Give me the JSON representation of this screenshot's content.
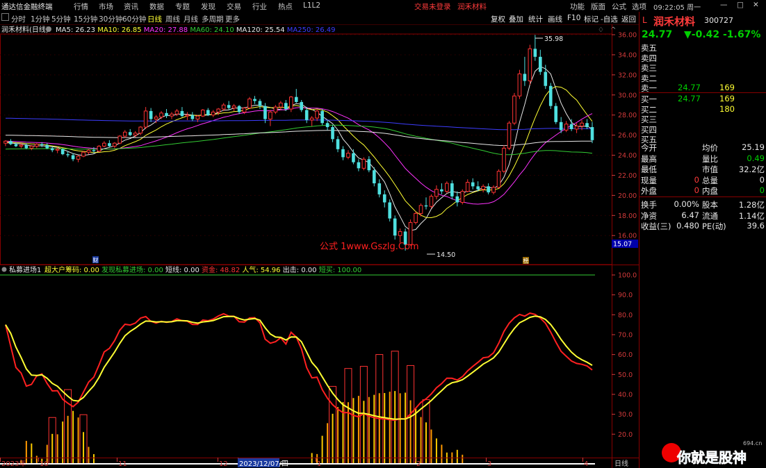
{
  "menu": {
    "app": "通达信金融终端",
    "items": [
      "行情",
      "市场",
      "资讯",
      "数据",
      "专题",
      "发现",
      "交易",
      "行业",
      "热点",
      "L1L2"
    ],
    "alerts": [
      "交易未登录",
      "润禾材料"
    ],
    "right": [
      "功能",
      "版面",
      "公式",
      "选项"
    ],
    "clock": "09:22:05 周一"
  },
  "periods": [
    "分时",
    "1分钟",
    "5分钟",
    "15分钟",
    "30分钟",
    "60分钟",
    "日线",
    "周线",
    "月线",
    "多周期",
    "更多"
  ],
  "active_period": "日线",
  "toolbar": [
    "复权",
    "叠加",
    "统计",
    "画线",
    "F10",
    "标记",
    "-自选",
    "返回"
  ],
  "ma_legend": {
    "name": "润禾材料(日线)",
    "items": [
      {
        "label": "MA5: 26.23",
        "color": "#e8e8e8"
      },
      {
        "label": "MA10: 26.85",
        "color": "#ffff33"
      },
      {
        "label": "MA20: 27.88",
        "color": "#ff33ff"
      },
      {
        "label": "MA60: 24.10",
        "color": "#33cc33"
      },
      {
        "label": "MA120: 25.54",
        "color": "#e8e8e8"
      },
      {
        "label": "MA250: 26.49",
        "color": "#3d3dff"
      }
    ]
  },
  "price_axis": [
    "36.00",
    "34.00",
    "32.00",
    "30.00",
    "28.00",
    "26.00",
    "24.00",
    "22.00",
    "20.00",
    "18.00",
    "16.00"
  ],
  "last_price_tag": "15.07",
  "annotations": {
    "high": "35.98",
    "low": "14.50",
    "watermark": "公式 1www.Gszlg.Com",
    "marker1": "财",
    "marker2": "榜"
  },
  "indicator": {
    "name": "私募进场1",
    "items": [
      {
        "label": "超大户筹码: 0.00",
        "color": "#ffff33"
      },
      {
        "label": "发现私募进场: 0.00",
        "color": "#33cc33"
      },
      {
        "label": "短线: 0.00",
        "color": "#e8e8e8"
      },
      {
        "label": "资金: 48.82",
        "color": "#ff3333"
      },
      {
        "label": "人气: 54.96",
        "color": "#ffff33"
      },
      {
        "label": "出击: 0.00",
        "color": "#e8e8e8"
      },
      {
        "label": "短买: 100.00",
        "color": "#33cc33"
      }
    ],
    "axis": [
      "100.0",
      "90.0",
      "80.0",
      "70.0",
      "60.0",
      "50.0",
      "40.0",
      "30.0",
      "20.0"
    ]
  },
  "date_axis": {
    "labels": [
      "2023年",
      "10",
      "11",
      "12",
      "2023/12/07/四",
      "1",
      "2",
      "3",
      "4"
    ],
    "period": "日线"
  },
  "quote": {
    "code_prefix": "L",
    "name": "润禾材料",
    "code": "300727",
    "price": "24.77",
    "change": "▼-0.42",
    "pct": "-1.67%",
    "sells": [
      {
        "label": "卖五",
        "price": "",
        "vol": ""
      },
      {
        "label": "卖四",
        "price": "",
        "vol": ""
      },
      {
        "label": "卖三",
        "price": "",
        "vol": ""
      },
      {
        "label": "卖二",
        "price": "",
        "vol": ""
      },
      {
        "label": "卖一",
        "price": "24.77",
        "vol": "169"
      }
    ],
    "buys": [
      {
        "label": "买一",
        "price": "24.77",
        "vol": "169"
      },
      {
        "label": "买二",
        "price": "",
        "vol": "180"
      },
      {
        "label": "买三",
        "price": "",
        "vol": ""
      },
      {
        "label": "买四",
        "price": "",
        "vol": ""
      },
      {
        "label": "买五",
        "price": "",
        "vol": ""
      }
    ],
    "stats": [
      {
        "l": "今开",
        "lv": "",
        "r": "均价",
        "rv": "25.19",
        "lc": "white",
        "rc": "white"
      },
      {
        "l": "最高",
        "lv": "",
        "r": "量比",
        "rv": "0.49",
        "lc": "white",
        "rc": "green"
      },
      {
        "l": "最低",
        "lv": "",
        "r": "市值",
        "rv": "32.2亿",
        "lc": "white",
        "rc": "white"
      },
      {
        "l": "现量",
        "lv": "0",
        "r": "总量",
        "rv": "0",
        "lc": "red",
        "rc": "white"
      },
      {
        "l": "外盘",
        "lv": "0",
        "r": "内盘",
        "rv": "0",
        "lc": "red",
        "rc": "green"
      }
    ],
    "stats2": [
      {
        "l": "换手",
        "lv": "0.00%",
        "r": "股本",
        "rv": "1.28亿"
      },
      {
        "l": "净资",
        "lv": "6.47",
        "r": "流通",
        "rv": "1.14亿"
      },
      {
        "l": "收益(三)",
        "lv": "0.480",
        "r": "PE(动)",
        "rv": "39.6"
      }
    ]
  },
  "logo": {
    "text": "你就是股神",
    "site": "694.cn"
  },
  "colors": {
    "up": "#ff3333",
    "down": "#4fe0e0",
    "bg": "#000000",
    "grid": "#800000"
  },
  "chart_data": {
    "type": "candlestick",
    "ohlc": [
      [
        25.2,
        25.5,
        24.9,
        25.4
      ],
      [
        25.4,
        25.6,
        25.0,
        25.1
      ],
      [
        25.1,
        25.3,
        24.8,
        24.9
      ],
      [
        24.9,
        25.2,
        24.7,
        25.0
      ],
      [
        25.0,
        25.2,
        24.6,
        24.7
      ],
      [
        24.7,
        25.0,
        24.5,
        24.9
      ],
      [
        24.9,
        25.2,
        24.7,
        25.1
      ],
      [
        25.1,
        25.3,
        24.8,
        25.0
      ],
      [
        25.0,
        25.2,
        24.6,
        24.7
      ],
      [
        24.7,
        24.9,
        24.3,
        24.5
      ],
      [
        24.5,
        24.8,
        24.2,
        24.6
      ],
      [
        24.6,
        24.7,
        24.0,
        24.1
      ],
      [
        24.1,
        24.4,
        23.8,
        24.0
      ],
      [
        24.0,
        24.2,
        23.4,
        23.6
      ],
      [
        23.6,
        24.0,
        23.3,
        23.9
      ],
      [
        23.9,
        24.4,
        23.8,
        24.3
      ],
      [
        24.3,
        24.6,
        24.1,
        24.5
      ],
      [
        24.5,
        24.8,
        24.2,
        24.4
      ],
      [
        24.4,
        25.0,
        24.3,
        24.9
      ],
      [
        24.9,
        25.4,
        24.8,
        25.2
      ],
      [
        25.2,
        25.5,
        24.8,
        24.9
      ],
      [
        24.9,
        25.3,
        24.7,
        25.2
      ],
      [
        25.2,
        26.0,
        25.1,
        25.9
      ],
      [
        25.9,
        26.5,
        25.7,
        26.3
      ],
      [
        26.3,
        26.6,
        25.9,
        26.0
      ],
      [
        26.0,
        26.4,
        25.8,
        26.2
      ],
      [
        26.2,
        26.9,
        26.0,
        26.8
      ],
      [
        26.8,
        28.8,
        26.6,
        28.4
      ],
      [
        28.4,
        28.7,
        27.3,
        27.6
      ],
      [
        27.6,
        28.0,
        27.2,
        27.8
      ],
      [
        27.8,
        28.4,
        27.6,
        28.2
      ],
      [
        28.2,
        28.6,
        27.7,
        27.9
      ],
      [
        27.9,
        28.3,
        27.6,
        28.1
      ],
      [
        28.1,
        28.6,
        27.9,
        28.4
      ],
      [
        28.4,
        28.8,
        27.8,
        27.9
      ],
      [
        27.9,
        28.3,
        27.5,
        28.0
      ],
      [
        28.0,
        28.3,
        27.4,
        27.6
      ],
      [
        27.6,
        28.0,
        27.3,
        27.9
      ],
      [
        27.9,
        28.6,
        27.8,
        28.5
      ],
      [
        28.5,
        28.7,
        27.9,
        28.0
      ],
      [
        28.0,
        28.5,
        27.8,
        28.3
      ],
      [
        28.3,
        28.7,
        28.0,
        28.6
      ],
      [
        28.6,
        29.2,
        28.4,
        29.0
      ],
      [
        29.0,
        29.4,
        28.5,
        28.7
      ],
      [
        28.7,
        29.1,
        28.4,
        28.9
      ],
      [
        28.9,
        29.0,
        28.1,
        28.3
      ],
      [
        28.3,
        28.8,
        28.1,
        28.7
      ],
      [
        28.7,
        29.8,
        28.6,
        29.6
      ],
      [
        29.6,
        29.9,
        29.1,
        29.4
      ],
      [
        29.4,
        29.6,
        28.6,
        28.9
      ],
      [
        28.9,
        29.2,
        27.2,
        27.6
      ],
      [
        27.6,
        28.5,
        26.9,
        28.3
      ],
      [
        28.3,
        29.0,
        28.1,
        28.8
      ],
      [
        28.8,
        29.4,
        28.5,
        29.2
      ],
      [
        29.2,
        29.5,
        28.4,
        28.6
      ],
      [
        28.6,
        29.9,
        28.3,
        29.8
      ],
      [
        29.8,
        30.6,
        29.2,
        29.3
      ],
      [
        29.3,
        29.5,
        28.3,
        28.5
      ],
      [
        28.5,
        28.8,
        27.2,
        27.5
      ],
      [
        27.5,
        27.9,
        26.9,
        27.7
      ],
      [
        27.7,
        28.6,
        27.4,
        28.4
      ],
      [
        28.4,
        28.6,
        27.0,
        27.2
      ],
      [
        27.2,
        27.5,
        26.5,
        26.8
      ],
      [
        26.8,
        27.0,
        25.3,
        25.6
      ],
      [
        25.6,
        25.9,
        24.3,
        24.6
      ],
      [
        24.6,
        24.9,
        23.5,
        23.8
      ],
      [
        23.8,
        24.5,
        23.6,
        24.2
      ],
      [
        24.2,
        24.6,
        23.1,
        23.3
      ],
      [
        23.3,
        23.6,
        22.4,
        22.7
      ],
      [
        22.7,
        23.8,
        22.5,
        23.6
      ],
      [
        23.6,
        23.9,
        22.3,
        22.5
      ],
      [
        22.5,
        22.8,
        20.9,
        21.2
      ],
      [
        21.2,
        21.6,
        19.8,
        20.1
      ],
      [
        20.1,
        20.5,
        18.8,
        19.3
      ],
      [
        19.3,
        19.6,
        17.4,
        17.7
      ],
      [
        17.7,
        18.0,
        15.6,
        16.0
      ],
      [
        16.0,
        16.7,
        15.3,
        16.4
      ],
      [
        16.4,
        16.7,
        14.5,
        15.1
      ],
      [
        15.1,
        17.6,
        15.0,
        17.3
      ],
      [
        17.3,
        18.4,
        17.1,
        18.2
      ],
      [
        18.2,
        19.2,
        17.9,
        19.0
      ],
      [
        19.0,
        19.8,
        18.6,
        18.9
      ],
      [
        18.9,
        20.1,
        18.7,
        19.9
      ],
      [
        19.9,
        21.0,
        19.6,
        20.6
      ],
      [
        20.6,
        21.2,
        20.1,
        20.4
      ],
      [
        20.4,
        21.4,
        20.2,
        21.2
      ],
      [
        21.2,
        21.5,
        19.6,
        19.9
      ],
      [
        19.9,
        20.4,
        18.9,
        19.3
      ],
      [
        19.3,
        20.6,
        19.1,
        20.4
      ],
      [
        20.4,
        21.6,
        20.3,
        21.3
      ],
      [
        21.3,
        21.7,
        20.6,
        20.9
      ],
      [
        20.9,
        21.4,
        20.4,
        20.6
      ],
      [
        20.6,
        21.1,
        20.3,
        20.9
      ],
      [
        20.9,
        21.2,
        20.1,
        20.3
      ],
      [
        20.3,
        21.0,
        20.1,
        20.8
      ],
      [
        20.8,
        22.6,
        20.7,
        22.4
      ],
      [
        22.4,
        25.0,
        22.2,
        24.7
      ],
      [
        24.7,
        27.4,
        24.5,
        27.2
      ],
      [
        27.2,
        30.2,
        27.0,
        29.9
      ],
      [
        29.9,
        32.5,
        29.6,
        32.1
      ],
      [
        32.1,
        33.8,
        30.9,
        31.4
      ],
      [
        31.4,
        35.0,
        31.0,
        34.6
      ],
      [
        34.6,
        35.98,
        33.4,
        33.8
      ],
      [
        33.8,
        34.5,
        32.0,
        32.3
      ],
      [
        32.3,
        33.0,
        30.6,
        30.9
      ],
      [
        30.9,
        31.2,
        28.6,
        28.9
      ],
      [
        28.9,
        29.2,
        27.1,
        27.3
      ],
      [
        27.3,
        27.8,
        26.2,
        26.5
      ],
      [
        26.5,
        27.4,
        26.3,
        27.1
      ],
      [
        27.1,
        27.6,
        26.4,
        26.6
      ],
      [
        26.6,
        27.2,
        26.2,
        26.9
      ],
      [
        26.9,
        27.5,
        26.5,
        27.2
      ],
      [
        27.2,
        27.6,
        26.6,
        26.8
      ],
      [
        26.8,
        27.3,
        25.2,
        25.5
      ]
    ],
    "y_range": [
      15.6,
      36.0
    ],
    "indicator_range": [
      18,
      100
    ]
  }
}
